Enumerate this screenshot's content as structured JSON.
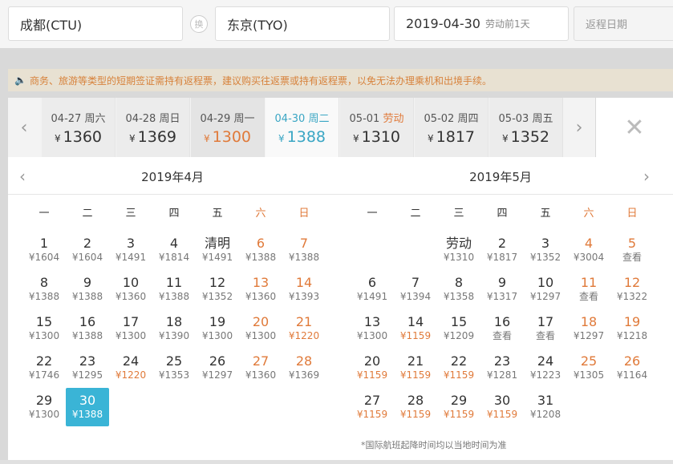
{
  "search": {
    "from": "成都(CTU)",
    "swap_icon": "换",
    "to": "东京(TYO)",
    "date": "2019-04-30",
    "date_sub": "劳动前1天",
    "return_placeholder": "返程日期"
  },
  "notice": {
    "icon": "speaker-icon",
    "text": "商务、旅游等类型的短期签证需持有返程票，建议购买往返票或持有返程票，以免无法办理乘机和出境手续。"
  },
  "strip": [
    {
      "label": "04-27 周六",
      "price": "1360",
      "state": "normal"
    },
    {
      "label": "04-28 周日",
      "price": "1369",
      "state": "normal"
    },
    {
      "label": "04-29 周一",
      "price": "1300",
      "state": "low"
    },
    {
      "label": "04-30 周二",
      "price": "1388",
      "state": "selected"
    },
    {
      "label": "05-01 ",
      "holiday": "劳动",
      "price": "1310",
      "state": "normal"
    },
    {
      "label": "05-02 周四",
      "price": "1817",
      "state": "normal"
    },
    {
      "label": "05-03 周五",
      "price": "1352",
      "state": "normal"
    }
  ],
  "currency": "¥",
  "weekdays": [
    "一",
    "二",
    "三",
    "四",
    "五",
    "六",
    "日"
  ],
  "months": [
    {
      "title": "2019年4月",
      "days": [
        {
          "d": "1",
          "p": "¥1604"
        },
        {
          "d": "2",
          "p": "¥1604"
        },
        {
          "d": "3",
          "p": "¥1491"
        },
        {
          "d": "4",
          "p": "¥1814"
        },
        {
          "d": "清明",
          "p": "¥1491"
        },
        {
          "d": "6",
          "p": "¥1388"
        },
        {
          "d": "7",
          "p": "¥1388"
        },
        {
          "d": "8",
          "p": "¥1388"
        },
        {
          "d": "9",
          "p": "¥1388"
        },
        {
          "d": "10",
          "p": "¥1360"
        },
        {
          "d": "11",
          "p": "¥1388"
        },
        {
          "d": "12",
          "p": "¥1352"
        },
        {
          "d": "13",
          "p": "¥1360"
        },
        {
          "d": "14",
          "p": "¥1393"
        },
        {
          "d": "15",
          "p": "¥1300"
        },
        {
          "d": "16",
          "p": "¥1388"
        },
        {
          "d": "17",
          "p": "¥1300"
        },
        {
          "d": "18",
          "p": "¥1390"
        },
        {
          "d": "19",
          "p": "¥1300"
        },
        {
          "d": "20",
          "p": "¥1300"
        },
        {
          "d": "21",
          "p": "¥1220",
          "low": true
        },
        {
          "d": "22",
          "p": "¥1746"
        },
        {
          "d": "23",
          "p": "¥1295"
        },
        {
          "d": "24",
          "p": "¥1220",
          "low": true
        },
        {
          "d": "25",
          "p": "¥1353"
        },
        {
          "d": "26",
          "p": "¥1297"
        },
        {
          "d": "27",
          "p": "¥1360"
        },
        {
          "d": "28",
          "p": "¥1369"
        },
        {
          "d": "29",
          "p": "¥1300"
        },
        {
          "d": "30",
          "p": "¥1388",
          "sel": true
        }
      ],
      "offset": 0
    },
    {
      "title": "2019年5月",
      "days": [
        {
          "d": "劳动",
          "p": "¥1310"
        },
        {
          "d": "2",
          "p": "¥1817"
        },
        {
          "d": "3",
          "p": "¥1352"
        },
        {
          "d": "4",
          "p": "¥3004"
        },
        {
          "d": "5",
          "p": "查看"
        },
        {
          "d": "6",
          "p": "¥1491"
        },
        {
          "d": "7",
          "p": "¥1394"
        },
        {
          "d": "8",
          "p": "¥1358"
        },
        {
          "d": "9",
          "p": "¥1317"
        },
        {
          "d": "10",
          "p": "¥1297"
        },
        {
          "d": "11",
          "p": "查看"
        },
        {
          "d": "12",
          "p": "¥1322"
        },
        {
          "d": "13",
          "p": "¥1300"
        },
        {
          "d": "14",
          "p": "¥1159",
          "low": true
        },
        {
          "d": "15",
          "p": "¥1209"
        },
        {
          "d": "16",
          "p": "查看"
        },
        {
          "d": "17",
          "p": "查看"
        },
        {
          "d": "18",
          "p": "¥1297"
        },
        {
          "d": "19",
          "p": "¥1218"
        },
        {
          "d": "20",
          "p": "¥1159",
          "low": true
        },
        {
          "d": "21",
          "p": "¥1159",
          "low": true
        },
        {
          "d": "22",
          "p": "¥1159",
          "low": true
        },
        {
          "d": "23",
          "p": "¥1281"
        },
        {
          "d": "24",
          "p": "¥1223"
        },
        {
          "d": "25",
          "p": "¥1305"
        },
        {
          "d": "26",
          "p": "¥1164"
        },
        {
          "d": "27",
          "p": "¥1159",
          "low": true
        },
        {
          "d": "28",
          "p": "¥1159",
          "low": true
        },
        {
          "d": "29",
          "p": "¥1159",
          "low": true
        },
        {
          "d": "30",
          "p": "¥1159",
          "low": true
        },
        {
          "d": "31",
          "p": "¥1208"
        }
      ],
      "offset": 2
    }
  ],
  "footnote": "*国际航班起降时间均以当地时间为准",
  "colors": {
    "accent": "#3ab4d6",
    "weekend": "#e07a3a",
    "low_price": "#e07a3a"
  }
}
